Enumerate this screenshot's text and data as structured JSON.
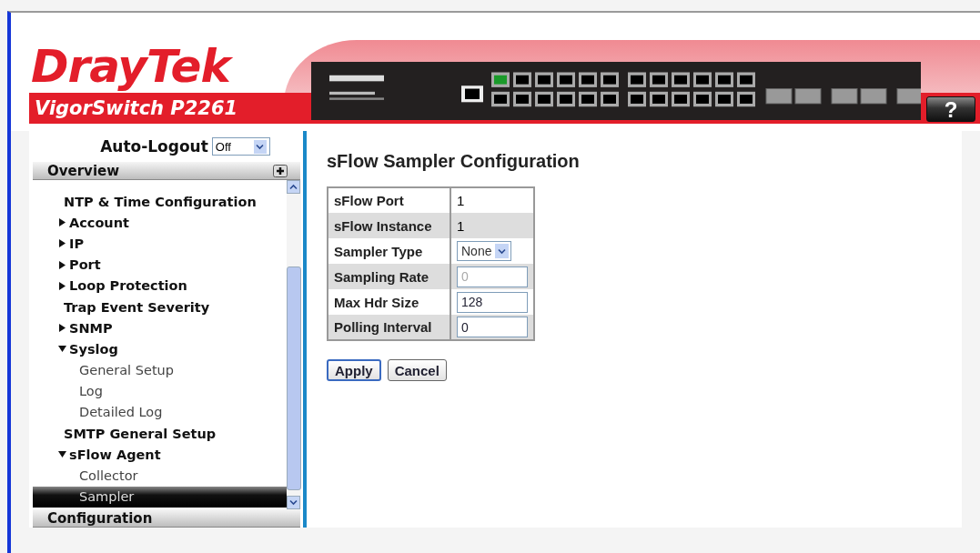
{
  "header": {
    "logo": "DrayTek",
    "model": "VigorSwitch P2261",
    "help_button": "?"
  },
  "sidebar": {
    "auto_logout": {
      "label": "Auto-Logout",
      "value": "Off"
    },
    "sections": [
      {
        "label": "Overview",
        "expanded": true
      },
      {
        "label": "Configuration",
        "expanded": false
      }
    ],
    "items": [
      {
        "label": "NTP & Time Configuration",
        "kind": "page",
        "selected": false
      },
      {
        "label": "Account",
        "kind": "folder",
        "expanded": false,
        "selected": false
      },
      {
        "label": "IP",
        "kind": "folder",
        "expanded": false,
        "selected": false
      },
      {
        "label": "Port",
        "kind": "folder",
        "expanded": false,
        "selected": false
      },
      {
        "label": "Loop Protection",
        "kind": "folder",
        "expanded": false,
        "selected": false
      },
      {
        "label": "Trap Event Severity",
        "kind": "page",
        "selected": false
      },
      {
        "label": "SNMP",
        "kind": "folder",
        "expanded": false,
        "selected": false
      },
      {
        "label": "Syslog",
        "kind": "folder",
        "expanded": true,
        "selected": false,
        "children": [
          {
            "label": "General Setup",
            "selected": false
          },
          {
            "label": "Log",
            "selected": false
          },
          {
            "label": "Detailed Log",
            "selected": false
          }
        ]
      },
      {
        "label": "SMTP General Setup",
        "kind": "page",
        "selected": false
      },
      {
        "label": "sFlow Agent",
        "kind": "folder",
        "expanded": true,
        "selected": false,
        "children": [
          {
            "label": "Collector",
            "selected": false
          },
          {
            "label": "Sampler",
            "selected": true
          }
        ]
      }
    ]
  },
  "form": {
    "title": "sFlow Sampler Configuration",
    "rows": [
      {
        "label": "sFlow Port",
        "kind": "text",
        "value": "1"
      },
      {
        "label": "sFlow Instance",
        "kind": "text",
        "value": "1"
      },
      {
        "label": "Sampler Type",
        "kind": "select",
        "value": "None"
      },
      {
        "label": "Sampling Rate",
        "kind": "input",
        "value": "0",
        "disabled": true
      },
      {
        "label": "Max Hdr Size",
        "kind": "input",
        "value": "128",
        "disabled": false
      },
      {
        "label": "Polling Interval",
        "kind": "input",
        "value": "0",
        "disabled": false
      }
    ],
    "buttons": [
      {
        "label": "Apply",
        "selected": true
      },
      {
        "label": "Cancel",
        "selected": false
      }
    ]
  }
}
